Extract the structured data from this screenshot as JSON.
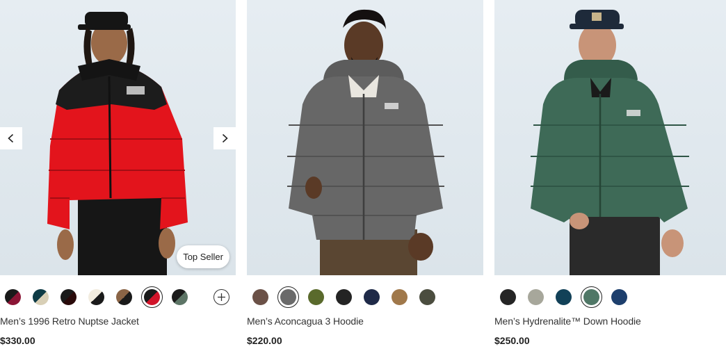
{
  "products": [
    {
      "name": "Men’s 1996 Retro Nuptse Jacket",
      "price": "$330.00",
      "badge": "Top Seller",
      "jacket_color": "#e3141c",
      "yoke_color": "#1c1c1c",
      "pants_color": "#1a1a1a",
      "hat_color": "#1a1a1a",
      "swatches": [
        {
          "a": "#1a1a1a",
          "b": "#8b1535",
          "selected": false
        },
        {
          "a": "#0e3b45",
          "b": "#d8cfb6",
          "selected": false
        },
        {
          "a": "#1a1a1a",
          "b": "#2a0a0a",
          "selected": false
        },
        {
          "a": "#f2ecdf",
          "b": "#1a1a1a",
          "selected": false
        },
        {
          "a": "#8a6446",
          "b": "#1a1a1a",
          "selected": false
        },
        {
          "a": "#1a1a1a",
          "b": "#d1142a",
          "selected": true
        },
        {
          "a": "#1a1a1a",
          "b": "#5d7566",
          "selected": false
        }
      ],
      "more_colors_icon": "plus-circle-icon"
    },
    {
      "name": "Men’s Aconcagua 3 Hoodie",
      "price": "$220.00",
      "jacket_color": "#676767",
      "yoke_color": "#676767",
      "pants_color": "#5a4632",
      "swatches": [
        {
          "a": "#6b5147",
          "b": "#6b5147",
          "selected": false
        },
        {
          "a": "#6a6a6a",
          "b": "#6a6a6a",
          "selected": true
        },
        {
          "a": "#5a6a2c",
          "b": "#5a6a2c",
          "selected": false
        },
        {
          "a": "#242424",
          "b": "#242424",
          "selected": false
        },
        {
          "a": "#1f2a48",
          "b": "#1f2a48",
          "selected": false
        },
        {
          "a": "#a0784a",
          "b": "#a0784a",
          "selected": false
        },
        {
          "a": "#4b4d3f",
          "b": "#4b4d3f",
          "selected": false
        }
      ]
    },
    {
      "name": "Men’s Hydrenalite™ Down Hoodie",
      "price": "$250.00",
      "jacket_color": "#3e6a57",
      "yoke_color": "#3e6a57",
      "pants_color": "#2a2a2a",
      "hat_color": "#1e2a3a",
      "swatches": [
        {
          "a": "#252525",
          "b": "#252525",
          "selected": false
        },
        {
          "a": "#a7a79b",
          "b": "#a7a79b",
          "selected": false
        },
        {
          "a": "#124158",
          "b": "#124158",
          "selected": false
        },
        {
          "a": "#4f7766",
          "b": "#4f7766",
          "selected": true
        },
        {
          "a": "#1d3f6d",
          "b": "#1d3f6d",
          "selected": false
        }
      ]
    }
  ],
  "carousel": {
    "prev_icon": "chevron-left-icon",
    "next_icon": "chevron-right-icon"
  }
}
